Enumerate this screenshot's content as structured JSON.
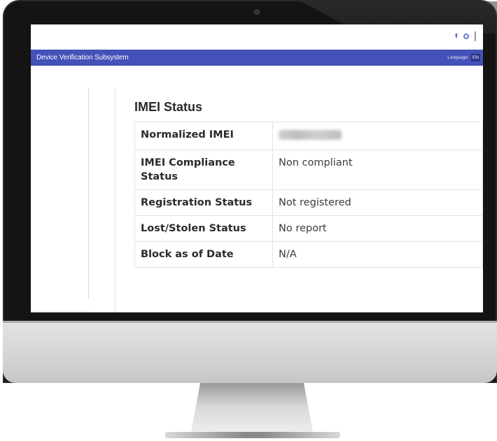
{
  "app": {
    "brand": "Device Verification Subsystem",
    "language_label": "Language:",
    "language_code": "EN",
    "nav_color": "#4351b8"
  },
  "top_icons": [
    "user-icon",
    "gear-icon"
  ],
  "imei_status": {
    "title": "IMEI Status",
    "rows": [
      {
        "label": "Normalized IMEI",
        "value": ""
      },
      {
        "label": "IMEI Compliance Status",
        "value": "Non compliant"
      },
      {
        "label": "Registration Status",
        "value": "Not registered"
      },
      {
        "label": "Lost/Stolen Status",
        "value": "No report"
      },
      {
        "label": "Block as of Date",
        "value": "N/A"
      }
    ]
  }
}
